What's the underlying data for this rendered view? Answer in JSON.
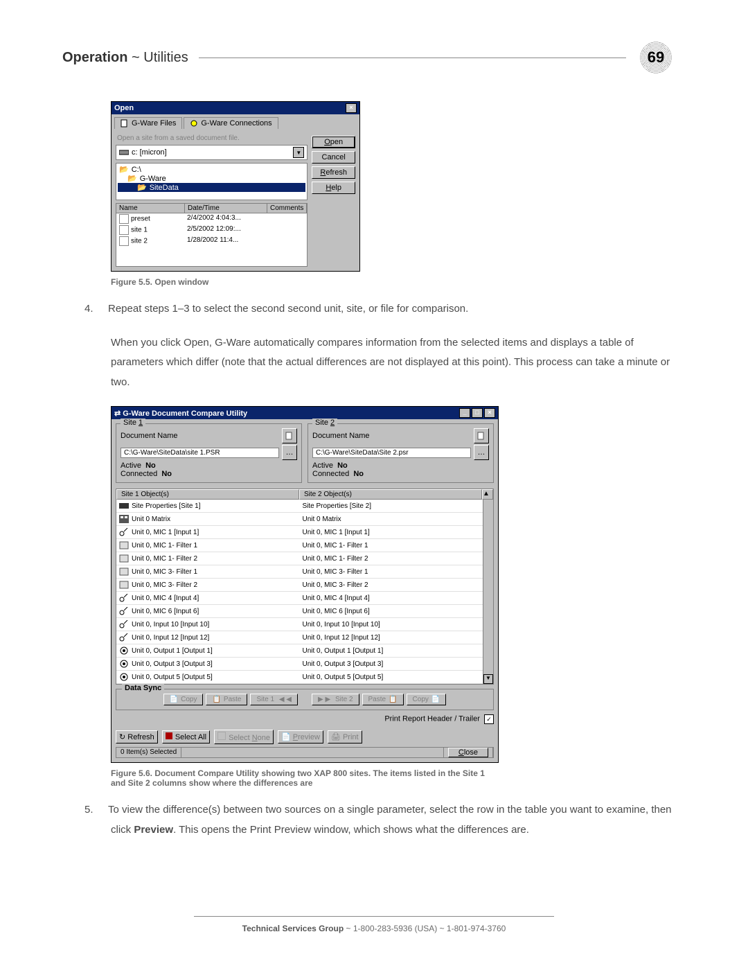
{
  "header": {
    "strong": "Operation",
    "sep": " ~ ",
    "light": "Utilities"
  },
  "page_number": "69",
  "open_dialog": {
    "title": "Open",
    "tabs": [
      "G-Ware Files",
      "G-Ware Connections"
    ],
    "hint": "Open a site from a saved document file.",
    "drive": "c: [micron]",
    "tree": [
      "C:\\",
      "G-Ware",
      "SiteData"
    ],
    "columns": [
      "Name",
      "Date/Time",
      "Comments"
    ],
    "files": [
      {
        "name": "preset",
        "dt": "2/4/2002 4:04:3..."
      },
      {
        "name": "site 1",
        "dt": "2/5/2002 12:09:..."
      },
      {
        "name": "site 2",
        "dt": "1/28/2002 11:4..."
      }
    ],
    "buttons": {
      "open": "Open",
      "cancel": "Cancel",
      "refresh": "Refresh",
      "help": "Help"
    }
  },
  "caption1": "Figure 5.5. Open window",
  "step4_num": "4.",
  "para1": "Repeat steps 1–3 to select the second second unit, site, or file for comparison.",
  "para2": "When you click Open, G-Ware automatically compares information from the selected items and displays a table of parameters which differ (note that the actual differences are not displayed at this point). This process can take a minute or two.",
  "cmp": {
    "title": "G-Ware Document Compare Utility",
    "site1": {
      "legend": "Site 1",
      "docname_label": "Document Name",
      "path": "C:\\G-Ware\\SiteData\\site 1.PSR",
      "active_label": "Active",
      "active": "No",
      "conn_label": "Connected",
      "conn": "No"
    },
    "site2": {
      "legend": "Site 2",
      "docname_label": "Document Name",
      "path": "C:\\G-Ware\\SiteData\\Site 2.psr",
      "active_label": "Active",
      "active": "No",
      "conn_label": "Connected",
      "conn": "No"
    },
    "col1_header": "Site 1 Object(s)",
    "col2_header": "Site 2 Object(s)",
    "rows1": [
      "Site Properties [Site 1]",
      "Unit 0 Matrix",
      "Unit 0, MIC 1 [Input 1]",
      "Unit 0, MIC 1- Filter 1",
      "Unit 0, MIC 1- Filter 2",
      "Unit 0, MIC 3- Filter 1",
      "Unit 0, MIC 3- Filter 2",
      "Unit 0, MIC 4 [Input 4]",
      "Unit 0, MIC 6 [Input 6]",
      "Unit 0, Input 10 [Input 10]",
      "Unit 0, Input 12 [Input 12]",
      "Unit 0, Output 1 [Output 1]",
      "Unit 0, Output 3 [Output 3]",
      "Unit 0, Output 5 [Output 5]"
    ],
    "rows2": [
      "Site Properties [Site 2]",
      "Unit 0 Matrix",
      "Unit 0, MIC 1 [Input 1]",
      "Unit 0, MIC 1- Filter 1",
      "Unit 0, MIC 1- Filter 2",
      "Unit 0, MIC 3- Filter 1",
      "Unit 0, MIC 3- Filter 2",
      "Unit 0, MIC 4 [Input 4]",
      "Unit 0, MIC 6 [Input 6]",
      "Unit 0, Input 10 [Input 10]",
      "Unit 0, Input 12 [Input 12]",
      "Unit 0, Output 1 [Output 1]",
      "Unit 0, Output 3 [Output 3]",
      "Unit 0, Output 5 [Output 5]"
    ],
    "datasync_label": "Data Sync",
    "ds_buttons": {
      "copy": "Copy",
      "paste": "Paste",
      "site1": "Site 1",
      "site2": "Site 2",
      "paste2": "Paste",
      "copy2": "Copy"
    },
    "report_label": "Print Report Header / Trailer",
    "bottom": {
      "refresh": "Refresh",
      "selectall": "Select All",
      "selectnone": "Select None",
      "preview": "Preview",
      "print": "Print"
    },
    "status_left": "0 Item(s) Selected",
    "close": "Close"
  },
  "caption2": "Figure 5.6. Document Compare Utility showing two XAP 800 sites. The items listed in the Site 1 and Site 2 columns show where the differences are",
  "step5_num": "5.",
  "para3a": "To view the difference(s) between two sources on a single parameter, select the row in the table you want to examine, then click ",
  "para3b_bold": "Preview",
  "para3c": ". This opens the Print Preview window, which shows what the differences are.",
  "footer": {
    "strong": "Technical Services Group",
    "rest": " ~ 1-800-283-5936 (USA) ~ 1-801-974-3760"
  }
}
